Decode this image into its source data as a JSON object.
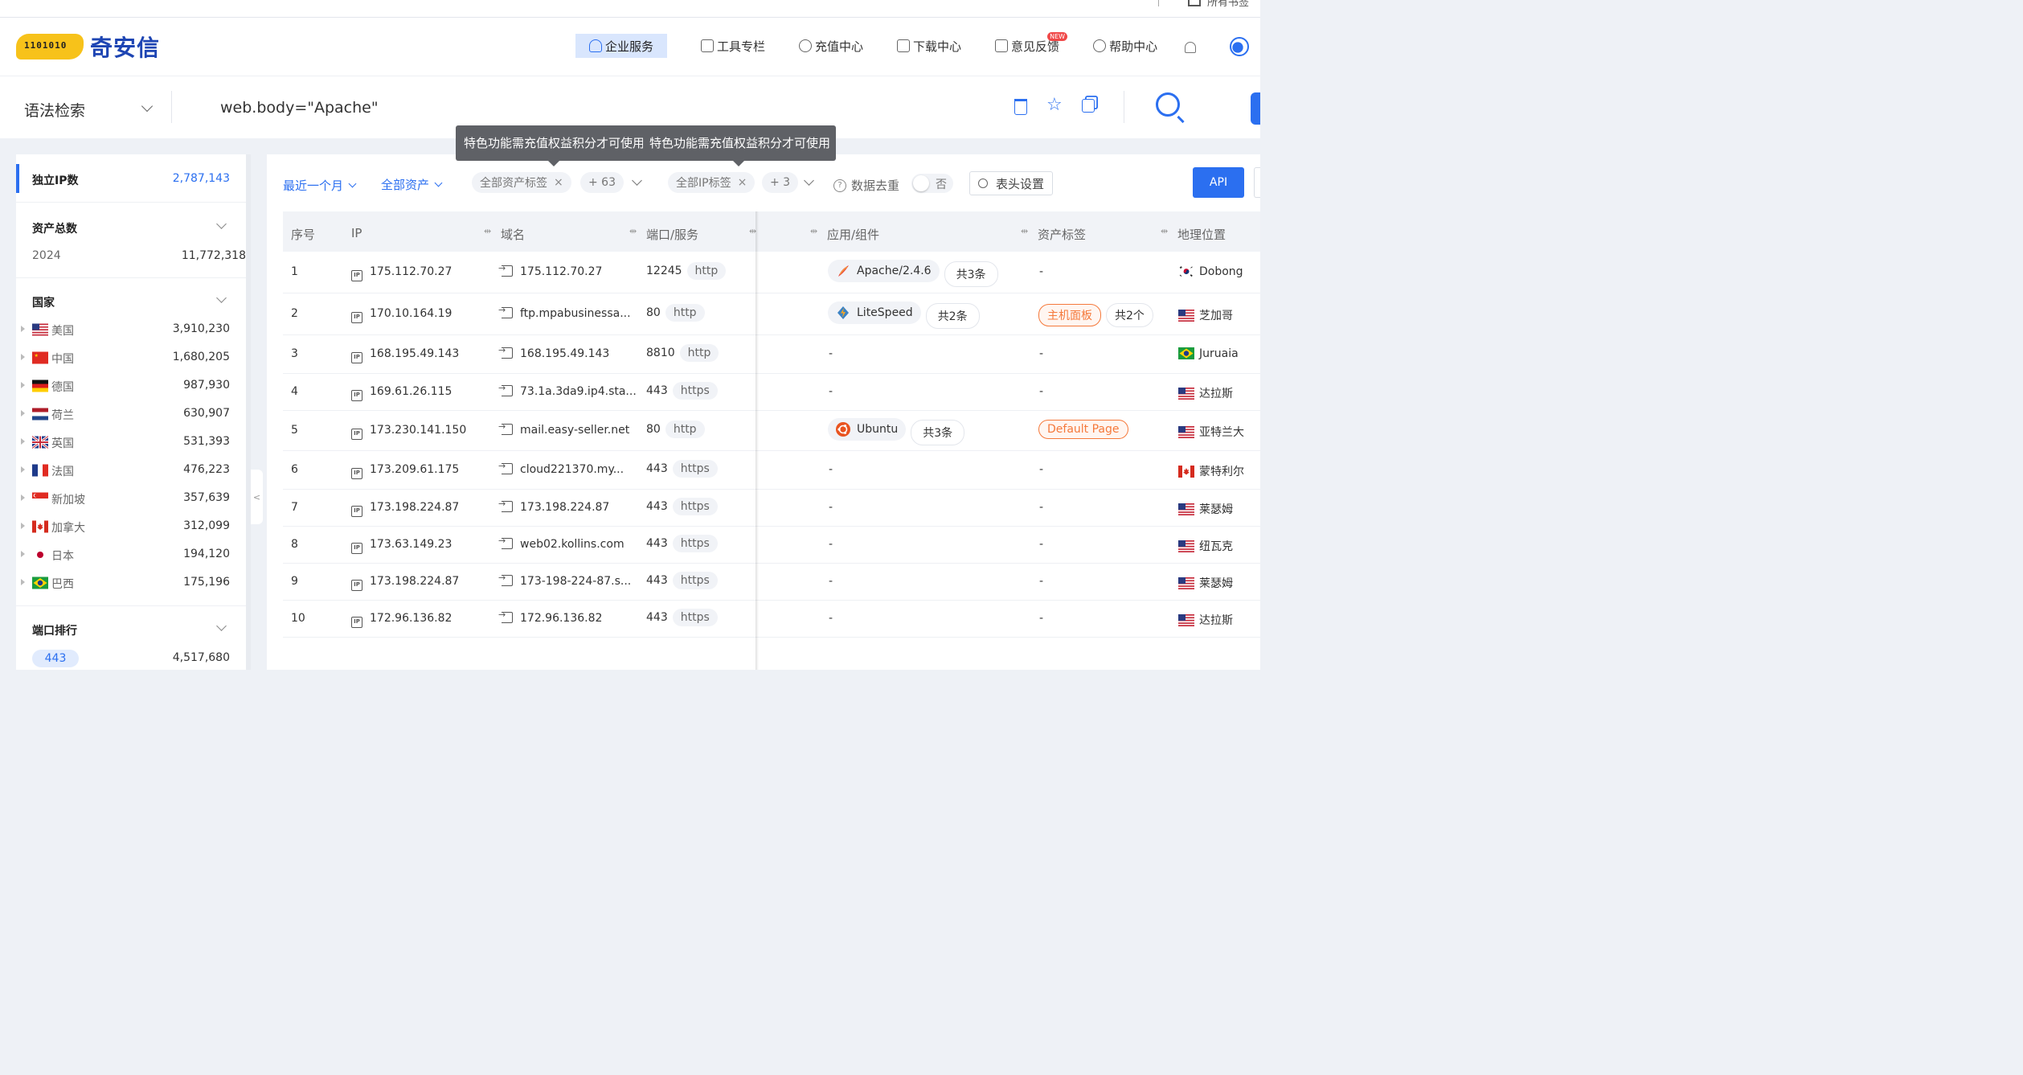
{
  "top_strip": {
    "partial_text": "所有书签"
  },
  "brand": {
    "name": "奇安信",
    "bits": "1101010"
  },
  "nav": [
    {
      "label": "企业服务",
      "icon": "enterprise-icon"
    },
    {
      "label": "工具专栏",
      "icon": "toolbox-icon"
    },
    {
      "label": "充值中心",
      "icon": "recharge-icon"
    },
    {
      "label": "下载中心",
      "icon": "download-icon"
    },
    {
      "label": "意见反馈",
      "icon": "feedback-icon",
      "badge": "NEW"
    },
    {
      "label": "帮助中心",
      "icon": "help-icon"
    }
  ],
  "search": {
    "mode": "语法检索",
    "query": "web.body=\"Apache\""
  },
  "sidebar": {
    "selected": {
      "label": "独立IP数",
      "value": "2,787,143"
    },
    "assets": {
      "title": "资产总数",
      "year": "2024",
      "value": "11,772,318"
    },
    "country_title": "国家",
    "countries": [
      {
        "name": "美国",
        "value": "3,910,230"
      },
      {
        "name": "中国",
        "value": "1,680,205"
      },
      {
        "name": "德国",
        "value": "987,930"
      },
      {
        "name": "荷兰",
        "value": "630,907"
      },
      {
        "name": "英国",
        "value": "531,393"
      },
      {
        "name": "法国",
        "value": "476,223"
      },
      {
        "name": "新加坡",
        "value": "357,639"
      },
      {
        "name": "加拿大",
        "value": "312,099"
      },
      {
        "name": "日本",
        "value": "194,120"
      },
      {
        "name": "巴西",
        "value": "175,196"
      }
    ],
    "port_title": "端口排行",
    "top_port": {
      "port": "443",
      "value": "4,517,680"
    },
    "collapse": "<"
  },
  "filters": {
    "time": "最近一个月",
    "assets": "全部资产",
    "asset_tags": "全部资产标签",
    "asset_tags_more": "+ 63",
    "ip_tags": "全部IP标签",
    "ip_tags_more": "+ 3",
    "dedupe_label": "数据去重",
    "dedupe_value": "否",
    "header_settings": "表头设置",
    "api": "API"
  },
  "tooltip": "特色功能需充值权益积分才可使用",
  "table": {
    "columns": [
      "序号",
      "IP",
      "域名",
      "端口/服务",
      "应用/组件",
      "资产标签",
      "地理位置"
    ],
    "rows": [
      {
        "n": "1",
        "ip": "175.112.70.27",
        "domain": "175.112.70.27",
        "port": "12245",
        "svc": "http",
        "comp": "Apache/2.4.6",
        "comp_icon": "apache-feather-icon",
        "comp_count": "共3条",
        "tag": "-",
        "geo": "Dobong",
        "geo_flag": "kr"
      },
      {
        "n": "2",
        "ip": "170.10.164.19",
        "domain": "ftp.mpabusinessa...",
        "port": "80",
        "svc": "http",
        "comp": "LiteSpeed",
        "comp_icon": "litespeed-icon",
        "comp_count": "共2条",
        "tag": "主机面板",
        "tag_count": "共2个",
        "geo": "芝加哥",
        "geo_flag": "us"
      },
      {
        "n": "3",
        "ip": "168.195.49.143",
        "domain": "168.195.49.143",
        "port": "8810",
        "svc": "http",
        "comp": "-",
        "tag": "-",
        "geo": "Juruaia",
        "geo_flag": "br"
      },
      {
        "n": "4",
        "ip": "169.61.26.115",
        "domain": "73.1a.3da9.ip4.sta...",
        "port": "443",
        "svc": "https",
        "comp": "-",
        "tag": "-",
        "geo": "达拉斯",
        "geo_flag": "us"
      },
      {
        "n": "5",
        "ip": "173.230.141.150",
        "domain": "mail.easy-seller.net",
        "port": "80",
        "svc": "http",
        "comp": "Ubuntu",
        "comp_icon": "ubuntu-icon",
        "comp_count": "共3条",
        "tag": "Default Page",
        "geo": "亚特兰大",
        "geo_flag": "us"
      },
      {
        "n": "6",
        "ip": "173.209.61.175",
        "domain": "cloud221370.my...",
        "port": "443",
        "svc": "https",
        "comp": "-",
        "tag": "-",
        "geo": "蒙特利尔",
        "geo_flag": "ca"
      },
      {
        "n": "7",
        "ip": "173.198.224.87",
        "domain": "173.198.224.87",
        "port": "443",
        "svc": "https",
        "comp": "-",
        "tag": "-",
        "geo": "莱瑟姆",
        "geo_flag": "us"
      },
      {
        "n": "8",
        "ip": "173.63.149.23",
        "domain": "web02.kollins.com",
        "port": "443",
        "svc": "https",
        "comp": "-",
        "tag": "-",
        "geo": "纽瓦克",
        "geo_flag": "us"
      },
      {
        "n": "9",
        "ip": "173.198.224.87",
        "domain": "173-198-224-87.s...",
        "port": "443",
        "svc": "https",
        "comp": "-",
        "tag": "-",
        "geo": "莱瑟姆",
        "geo_flag": "us"
      },
      {
        "n": "10",
        "ip": "172.96.136.82",
        "domain": "172.96.136.82",
        "port": "443",
        "svc": "https",
        "comp": "-",
        "tag": "-",
        "geo": "达拉斯",
        "geo_flag": "us"
      }
    ]
  },
  "colors": {
    "accent": "#2b6ff0",
    "brand": "#1e45b3",
    "logo_yellow": "#f7c21a",
    "tag_orange": "#f5793b"
  }
}
